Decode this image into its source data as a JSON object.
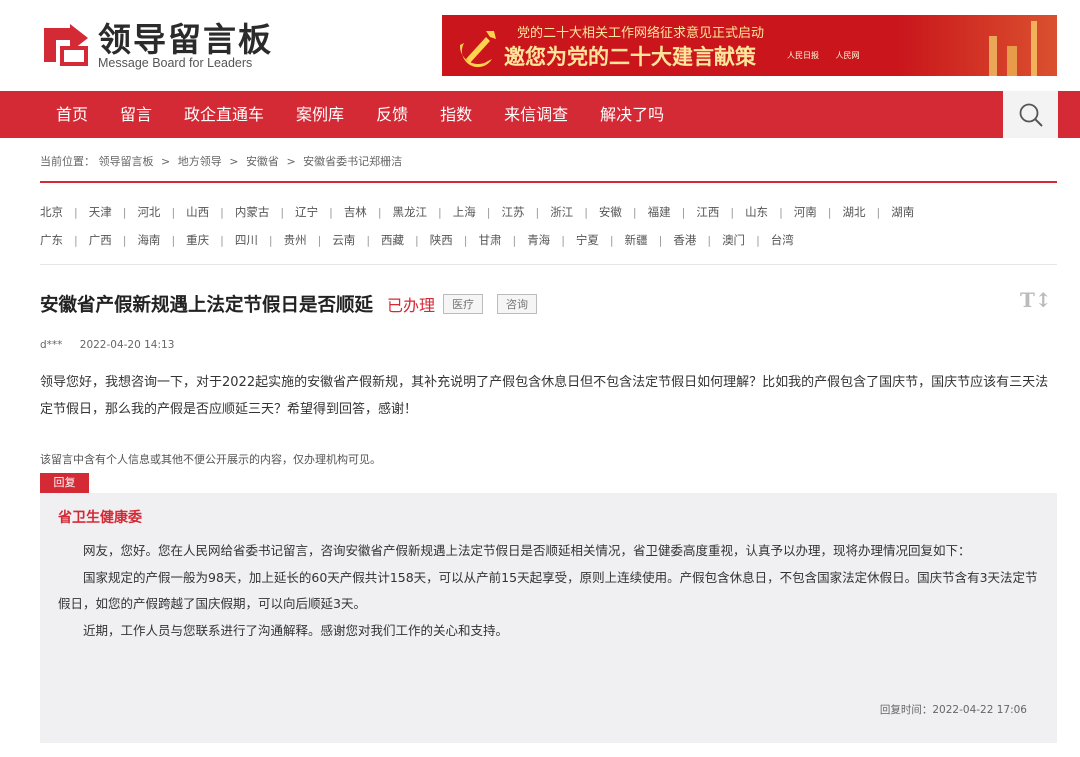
{
  "header": {
    "logo_cn": "领导留言板",
    "logo_en": "Message Board for Leaders",
    "banner_top": "党的二十大相关工作网络征求意见正式启动",
    "banner_main": "邀您为党的二十大建言献策",
    "banner_logo1": "人民日报",
    "banner_logo2": "人民网"
  },
  "nav": {
    "items": [
      "首页",
      "留言",
      "政企直通车",
      "案例库",
      "反馈",
      "指数",
      "来信调查",
      "解决了吗"
    ]
  },
  "breadcrumb": {
    "prefix": "当前位置：",
    "items": [
      "领导留言板",
      "地方领导",
      "安徽省",
      "安徽省委书记郑栅洁"
    ],
    "sep": ">"
  },
  "regions": {
    "row1": [
      "北京",
      "天津",
      "河北",
      "山西",
      "内蒙古",
      "辽宁",
      "吉林",
      "黑龙江",
      "上海",
      "江苏",
      "浙江",
      "安徽",
      "福建",
      "江西",
      "山东",
      "河南",
      "湖北",
      "湖南"
    ],
    "row2": [
      "广东",
      "广西",
      "海南",
      "重庆",
      "四川",
      "贵州",
      "云南",
      "西藏",
      "陕西",
      "甘肃",
      "青海",
      "宁夏",
      "新疆",
      "香港",
      "澳门",
      "台湾"
    ],
    "separator": "|"
  },
  "message": {
    "title": "安徽省产假新规遇上法定节假日是否顺延",
    "status": "已办理",
    "tag1": "医疗",
    "tag2": "咨询",
    "font_toggle": "T↕",
    "author": "d***",
    "date": "2022-04-20 14:13",
    "content": "领导您好，我想咨询一下，对于2022起实施的安徽省产假新规，其补充说明了产假包含休息日但不包含法定节假日如何理解？比如我的产假包含了国庆节，国庆节应该有三天法定节假日，那么我的产假是否应顺延三天？希望得到回答，感谢！",
    "notice": "该留言中含有个人信息或其他不便公开展示的内容，仅办理机构可见。"
  },
  "reply": {
    "tab_label": "回复",
    "org": "省卫生健康委",
    "p1": "网友，您好。您在人民网给省委书记留言，咨询安徽省产假新规遇上法定节假日是否顺延相关情况，省卫健委高度重视，认真予以办理，现将办理情况回复如下：",
    "p2": "国家规定的产假一般为98天，加上延长的60天产假共计158天，可以从产前15天起享受，原则上连续使用。产假包含休息日，不包含国家法定休假日。国庆节含有3天法定节假日，如您的产假跨越了国庆假期，可以向后顺延3天。",
    "p3": "近期，工作人员与您联系进行了沟通解释。感谢您对我们工作的关心和支持。",
    "time": "回复时间：2022-04-22 17:06"
  },
  "colors": {
    "brand_red": "#d42a35",
    "banner_red": "#c9151b"
  }
}
